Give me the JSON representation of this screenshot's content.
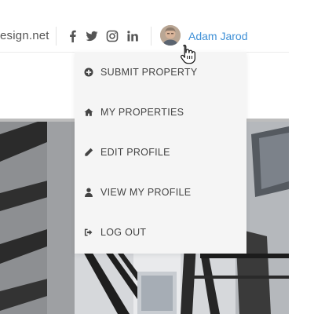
{
  "header": {
    "site_text": "esign.net",
    "social": [
      {
        "icon": "facebook-icon"
      },
      {
        "icon": "twitter-icon"
      },
      {
        "icon": "instagram-icon"
      },
      {
        "icon": "linkedin-icon"
      }
    ],
    "user": {
      "name": "Adam Jarod",
      "name_color": "#3d8fd6"
    }
  },
  "dropdown": {
    "items": [
      {
        "label": "SUBMIT PROPERTY",
        "icon": "plus-circle-icon"
      },
      {
        "label": "MY PROPERTIES",
        "icon": "home-icon"
      },
      {
        "label": "EDIT PROFILE",
        "icon": "pencil-icon"
      },
      {
        "label": "VIEW MY PROFILE",
        "icon": "user-icon"
      },
      {
        "label": "LOG OUT",
        "icon": "sign-out-icon"
      }
    ]
  }
}
